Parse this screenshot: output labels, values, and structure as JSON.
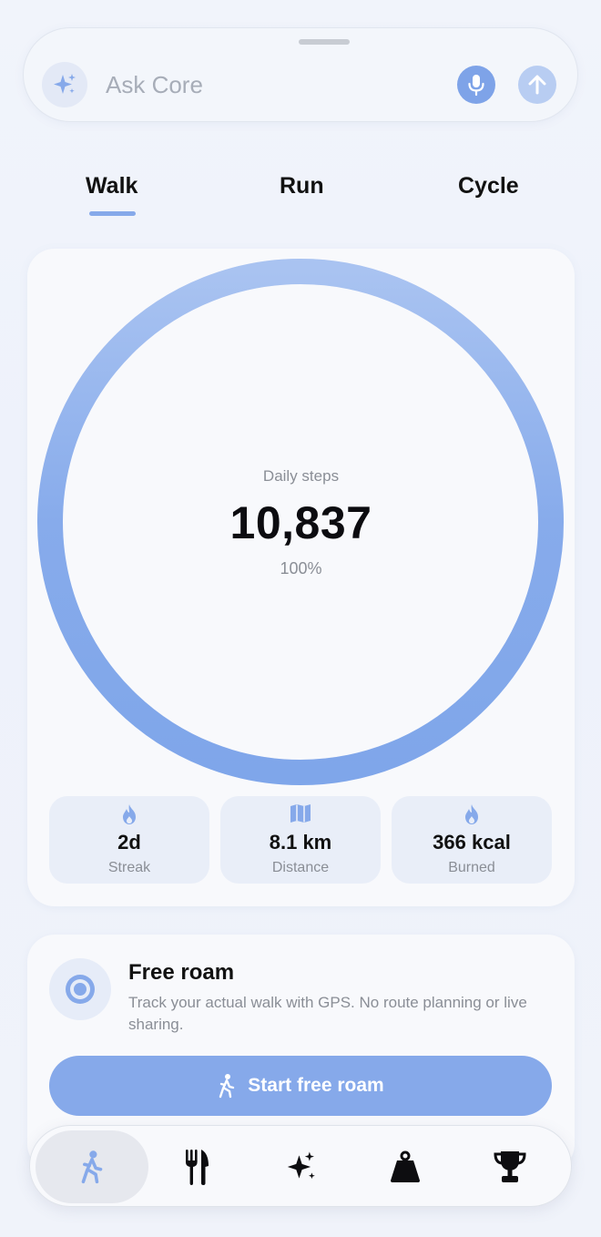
{
  "ask_bar": {
    "placeholder": "Ask Core",
    "icons": [
      "sparkles-icon",
      "microphone-icon",
      "arrow-up-icon"
    ]
  },
  "tabs": [
    {
      "label": "Walk",
      "active": true
    },
    {
      "label": "Run",
      "active": false
    },
    {
      "label": "Cycle",
      "active": false
    }
  ],
  "daily": {
    "label": "Daily steps",
    "value": "10,837",
    "percent_label": "100%",
    "progress": 1.0
  },
  "stats": [
    {
      "icon": "flame-icon",
      "value": "2d",
      "label": "Streak"
    },
    {
      "icon": "map-icon",
      "value": "8.1 km",
      "label": "Distance"
    },
    {
      "icon": "flame-icon",
      "value": "366 kcal",
      "label": "Burned"
    }
  ],
  "free_roam": {
    "title": "Free roam",
    "description": "Track your actual walk with GPS. No route planning or live sharing.",
    "button_label": "Start free roam",
    "icon": "location-target-icon"
  },
  "nav": [
    {
      "icon": "walk-icon",
      "active": true
    },
    {
      "icon": "fork-knife-icon",
      "active": false
    },
    {
      "icon": "sparkles-icon",
      "active": false
    },
    {
      "icon": "weight-icon",
      "active": false
    },
    {
      "icon": "trophy-icon",
      "active": false
    }
  ],
  "colors": {
    "accent": "#86a9ea",
    "accent_light": "#a9c3f1",
    "background": "#eef2fb",
    "card": "#f8f9fc"
  }
}
